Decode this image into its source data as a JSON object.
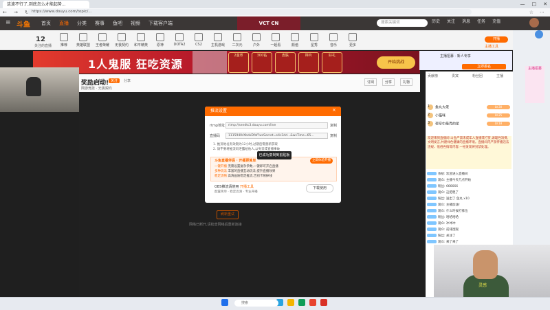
{
  "browser": {
    "tab_title": "这波不行了,到底怎么才能起势...",
    "url": "https://www.douyu.com/topic/...",
    "window_controls": [
      "—",
      "□",
      "✕"
    ],
    "nav_buttons": "← → ↻",
    "toolbar_icons": [
      "☆",
      "⋯"
    ]
  },
  "site": {
    "logo": "斗鱼",
    "menu_icon": "≡",
    "nav": [
      {
        "label": "首页",
        "active": false
      },
      {
        "label": "直播",
        "active": true
      },
      {
        "label": "分类",
        "active": false
      },
      {
        "label": "赛事",
        "active": false
      },
      {
        "label": "鱼吧",
        "active": false
      },
      {
        "label": "视频",
        "active": false
      },
      {
        "label": "下载客户端",
        "active": false
      }
    ],
    "event_logo": "VCT CN",
    "search_placeholder": "搜索关键词",
    "header_icons": [
      "历史",
      "关注",
      "消息",
      "任务",
      "充值"
    ],
    "accent": "#ff6b00"
  },
  "categories": {
    "follow_count": "12",
    "follow_label": "关注的直播",
    "items": [
      "推荐",
      "英雄联盟",
      "王者荣耀",
      "无畏契约",
      "和平精英",
      "原神",
      "DOTA2",
      "CS2",
      "主机游戏",
      "二次元",
      "户外",
      "一起看",
      "颜值",
      "星秀",
      "音乐",
      "更多"
    ],
    "open_live_label": "开播",
    "open_live_sub": "主播工具"
  },
  "banner": {
    "headline": "1人鬼服 狂吃资源",
    "prizes": [
      "2金币",
      "300钻",
      "皮肤",
      "碎片",
      "好礼"
    ],
    "button_label": "开始挑战"
  },
  "right_ad": {
    "text": "主播招募 · 新人专享",
    "button_label": "立即报名"
  },
  "room": {
    "title": "奖励启动!",
    "row": [
      "主播",
      "关注",
      "分享"
    ],
    "meta": "网游竞技 · 无畏契约",
    "header_buttons": [
      "订阅",
      "分享",
      "礼物"
    ]
  },
  "player": {
    "error_button": "刷新重试",
    "error_text": "网络已断开,请检查网络后重新连接"
  },
  "dialog": {
    "title": "推流设置",
    "close": "×",
    "rows": [
      {
        "label": "rtmp地址",
        "value": "rtmp://sendtc3.douyu.com/live",
        "copy": "复制"
      },
      {
        "label": "直播码",
        "value": "1115940rXbdxDfaf?wsSecret=e4c3dd...&wsTime=65...",
        "copy": "复制"
      }
    ],
    "notes": [
      "1. 推流地址有效期为12小时,过期后需重新获取",
      "2. 请不要将推流码泄露给他人,以免造成直播事故"
    ],
    "tooltip": "已成功复制到剪贴板",
    "tip_title": "斗鱼直播伴侣 · 开播更简单",
    "tip_button": "立即体验开播",
    "tip_lines": [
      {
        "tag": "一键开播",
        "text": "无需设置复杂参数,一键即可开启直播"
      },
      {
        "tag": "多种玩法",
        "text": "丰富的直播互动玩法,提升直播效果"
      },
      {
        "tag": "稳定流畅",
        "text": "高清画质稳定推流,告别卡顿掉线"
      }
    ],
    "tool_title_prefix": "OBS推流请使用 ",
    "tool_title_link": "开播工具",
    "tool_desc": "配置简单 · 稳定高清 · 专业开播",
    "download_button": "下载使用"
  },
  "side": {
    "tabs": [
      "贡献榜",
      "贵宾",
      "粉丝团",
      "主播"
    ],
    "ranks": [
      {
        "n": "1",
        "name": "鱼丸大佬",
        "tag": "LV.30"
      },
      {
        "n": "2",
        "name": "小猫咪",
        "tag": "LV.25"
      },
      {
        "n": "3",
        "name": "夜空中最亮的星",
        "tag": "LV.18"
      }
    ],
    "announcement": "欢迎来到直播间!斗鱼严禁未成年人直播或打赏,请理性消费,文明发言,共建绿色健康的直播环境。直播间内严禁传播违法违规、低俗色情等内容,一经发现将封禁处理。",
    "chat": [
      "系统: 欢迎进入直播间",
      "观众: 主播今天几点开始",
      "粉丝: 666666",
      "观众: 这把稳了",
      "粉丝: 送出了 鱼丸 x10",
      "观众: 主播加油!",
      "观众: 什么时候打排位",
      "粉丝: 哈哈哈哈",
      "观众: 冲冲冲",
      "观众: 前排围观",
      "粉丝: 关注了",
      "观众: 来了来了"
    ],
    "side_ad": "主播招募"
  },
  "webcam2": {
    "shirt_text": "灵感"
  },
  "taskbar": {
    "search_placeholder": "搜索",
    "icon_colors": [
      "#1f6feb",
      "#2aa3e0",
      "#f4b400",
      "#0f9d58",
      "#e8432e",
      "#d93025"
    ]
  }
}
